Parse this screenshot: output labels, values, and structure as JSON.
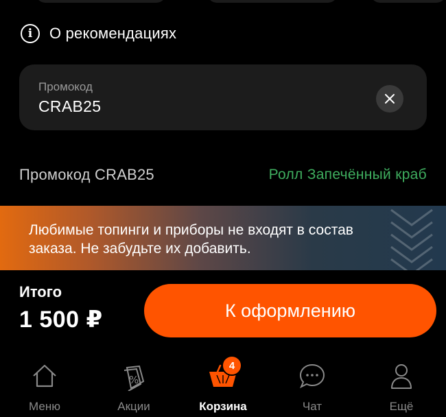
{
  "recommendations": {
    "label": "О рекомендациях",
    "icon": "info-icon"
  },
  "promo_field": {
    "label": "Промокод",
    "value": "CRAB25",
    "clear_icon": "close-icon"
  },
  "promo_result": {
    "name": "Промокод CRAB25",
    "gift": "Ролл Запечённый краб",
    "gift_color": "#3fae5f"
  },
  "banner": {
    "text": "Любимые топинги и приборы не входят в состав заказа. Не забудьте их добавить."
  },
  "summary": {
    "total_label": "Итого",
    "total_value": "1 500 ₽"
  },
  "checkout": {
    "label": "К оформлению",
    "color": "#ff5400"
  },
  "tabbar": {
    "items": [
      {
        "label": "Меню",
        "icon": "home-icon",
        "active": false
      },
      {
        "label": "Акции",
        "icon": "discount-tag-icon",
        "active": false
      },
      {
        "label": "Корзина",
        "icon": "basket-icon",
        "active": true,
        "badge": "4"
      },
      {
        "label": "Чат",
        "icon": "chat-icon",
        "active": false
      },
      {
        "label": "Ещё",
        "icon": "profile-icon",
        "active": false
      }
    ]
  }
}
